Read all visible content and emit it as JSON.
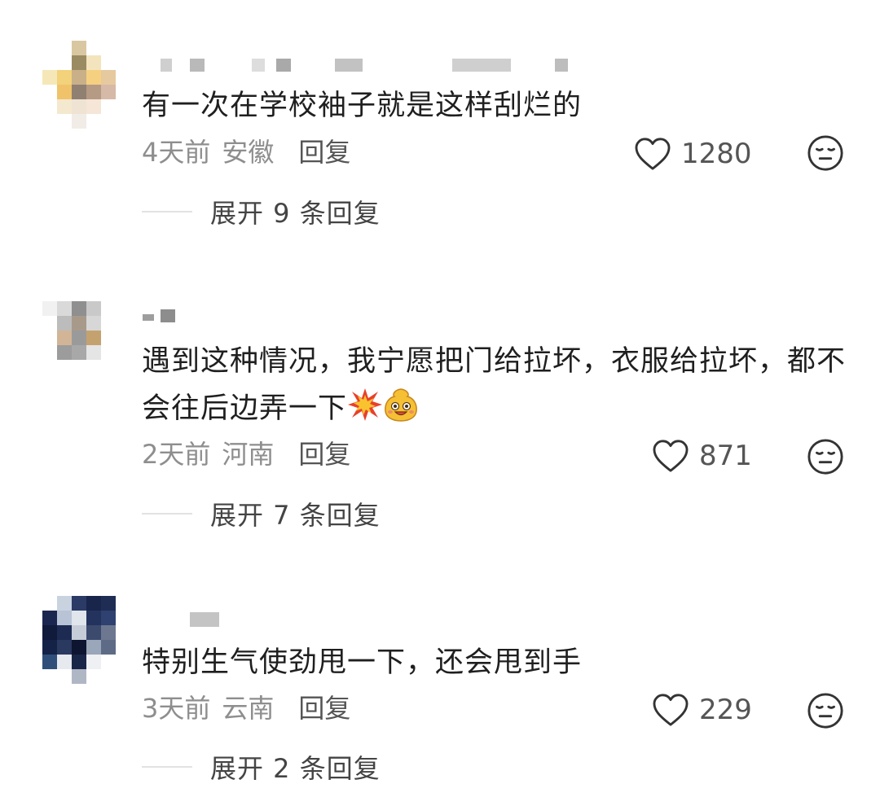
{
  "comments": [
    {
      "text": "有一次在学校袖子就是这样刮烂的",
      "time": "4天前",
      "location": "安徽",
      "reply_label": "回复",
      "likes": "1280",
      "expand_label": "展开 9 条回复"
    },
    {
      "text": "遇到这种情况，我宁愿把门给拉坏，衣服给拉坏，都不会往后边弄一下",
      "emojis": [
        "collision-emoji",
        "smiling-face-emoji"
      ],
      "time": "2天前",
      "location": "河南",
      "reply_label": "回复",
      "likes": "871",
      "expand_label": "展开 7 条回复"
    },
    {
      "text": "特别生气使劲甩一下，还会甩到手",
      "time": "3天前",
      "location": "云南",
      "reply_label": "回复",
      "likes": "229",
      "expand_label": "展开 2 条回复"
    }
  ],
  "icons": {
    "like": "heart-outline-icon",
    "dislike": "neutral-face-icon"
  },
  "colors": {
    "meta_gray": "#8e8e8e",
    "text": "#1f1f1f",
    "icon": "#333333"
  }
}
